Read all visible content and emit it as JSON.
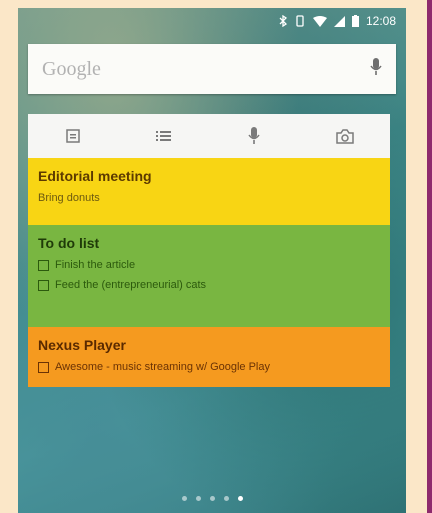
{
  "status_bar": {
    "time": "12:08",
    "icons": [
      "bluetooth-icon",
      "vibrate-icon",
      "wifi-icon",
      "signal-icon",
      "battery-icon"
    ]
  },
  "search": {
    "brand": "Google",
    "mic_icon": "mic-icon"
  },
  "keep_toolbar": {
    "items": [
      "new-note-icon",
      "list-icon",
      "voice-note-icon",
      "camera-icon"
    ]
  },
  "notes": [
    {
      "color": "#f8d514",
      "title": "Editorial meeting",
      "lines": [
        {
          "text": "Bring donuts",
          "checkbox": false
        }
      ]
    },
    {
      "color": "#79b641",
      "title": "To do list",
      "lines": [
        {
          "text": "Finish the article",
          "checkbox": true
        },
        {
          "text": "Feed the (entrepreneurial) cats",
          "checkbox": true
        }
      ]
    },
    {
      "color": "#f59a1f",
      "title": "Nexus Player",
      "lines": [
        {
          "text": "Awesome - music streaming w/ Google Play",
          "checkbox": true
        }
      ]
    }
  ],
  "page_indicator": {
    "count": 5,
    "active_index": 4
  }
}
